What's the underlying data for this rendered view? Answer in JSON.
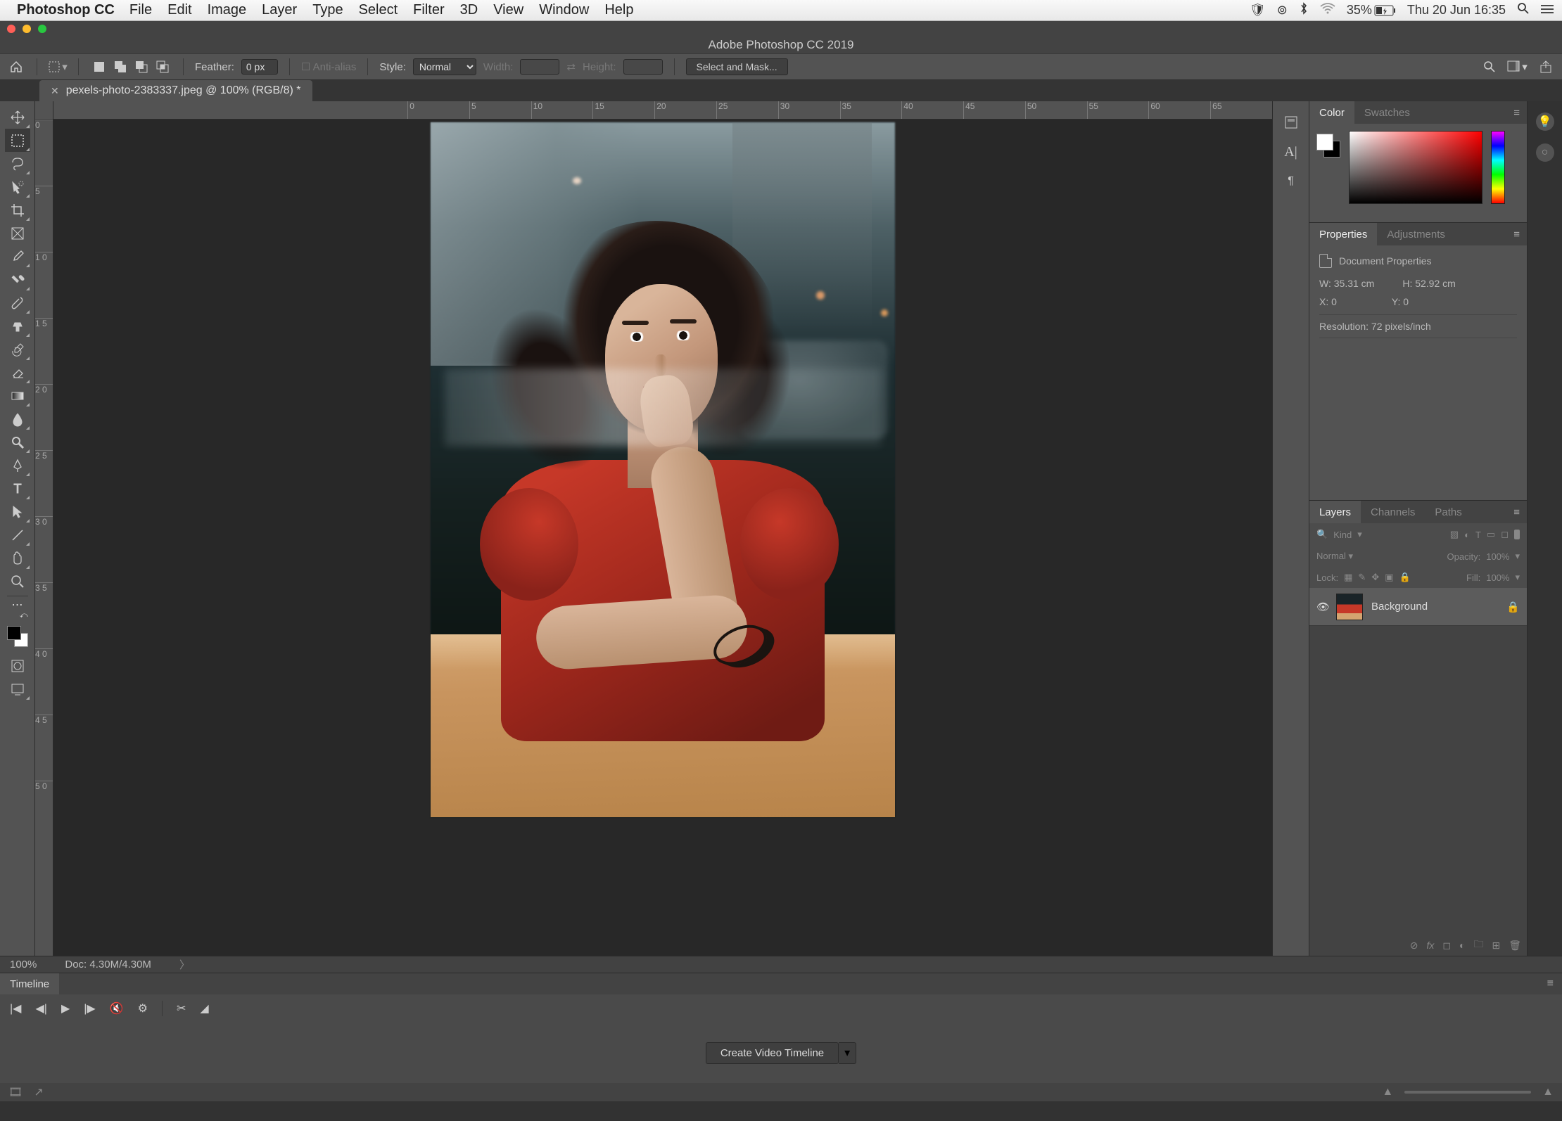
{
  "menubar": {
    "app": "Photoshop CC",
    "items": [
      "File",
      "Edit",
      "Image",
      "Layer",
      "Type",
      "Select",
      "Filter",
      "3D",
      "View",
      "Window",
      "Help"
    ],
    "battery": "35%",
    "datetime": "Thu 20 Jun  16:35"
  },
  "titlebar": "Adobe Photoshop CC 2019",
  "optionsbar": {
    "feather_label": "Feather:",
    "feather_value": "0 px",
    "antialias": "Anti-alias",
    "style_label": "Style:",
    "style_value": "Normal",
    "width_label": "Width:",
    "height_label": "Height:",
    "selectmask": "Select and Mask..."
  },
  "doc_tab": "pexels-photo-2383337.jpeg @ 100% (RGB/8) *",
  "ruler_h": [
    "25",
    "75",
    "125",
    "175",
    "225",
    "275",
    "325",
    "375",
    "425",
    "475",
    "525",
    "575",
    "625",
    "675",
    "725",
    "775",
    "825",
    "875",
    "925",
    "975",
    "1025",
    "1075"
  ],
  "ruler_h_start": [
    "",
    "",
    "",
    "",
    "",
    "",
    "0",
    "5",
    "10",
    "15",
    "20",
    "25",
    "30",
    "35",
    "40",
    "45",
    "50",
    "55",
    "60",
    "65"
  ],
  "ruler_v": [
    "0",
    "5",
    "1 0",
    "1 5",
    "2 0",
    "2 5",
    "3 0",
    "3 5",
    "4 0",
    "4 5",
    "5 0"
  ],
  "panels": {
    "color_tab": "Color",
    "swatches_tab": "Swatches",
    "properties_tab": "Properties",
    "adjustments_tab": "Adjustments",
    "docprops_label": "Document Properties",
    "W": "W: 35.31 cm",
    "H": "H: 52.92 cm",
    "X": "X: 0",
    "Y": "Y: 0",
    "resolution": "Resolution: 72 pixels/inch",
    "layers_tab": "Layers",
    "channels_tab": "Channels",
    "paths_tab": "Paths",
    "filter_kind": "Kind",
    "blend_mode": "Normal",
    "opacity_label": "Opacity:",
    "opacity_value": "100%",
    "lock_label": "Lock:",
    "fill_label": "Fill:",
    "fill_value": "100%",
    "layer_name": "Background"
  },
  "statusbar": {
    "zoom": "100%",
    "docsize": "Doc: 4.30M/4.30M"
  },
  "timeline": {
    "tab": "Timeline",
    "create_btn": "Create Video Timeline"
  }
}
